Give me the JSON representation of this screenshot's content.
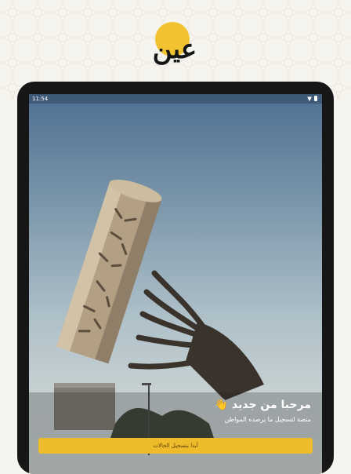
{
  "brand": {
    "logo_text": "عين",
    "accent": "#eebc2a"
  },
  "device": {
    "status_time": "11:54",
    "status_icons": [
      "wifi-icon",
      "battery-icon"
    ]
  },
  "hero": {
    "image": "monument-sculpture"
  },
  "welcome": {
    "title": "مرحبا من جديد",
    "emoji": "👋",
    "subtitle": "منصة لتسجيل ما يرصده المواطن"
  },
  "cta": {
    "label": "أبدا بتسجيل الحالات"
  }
}
